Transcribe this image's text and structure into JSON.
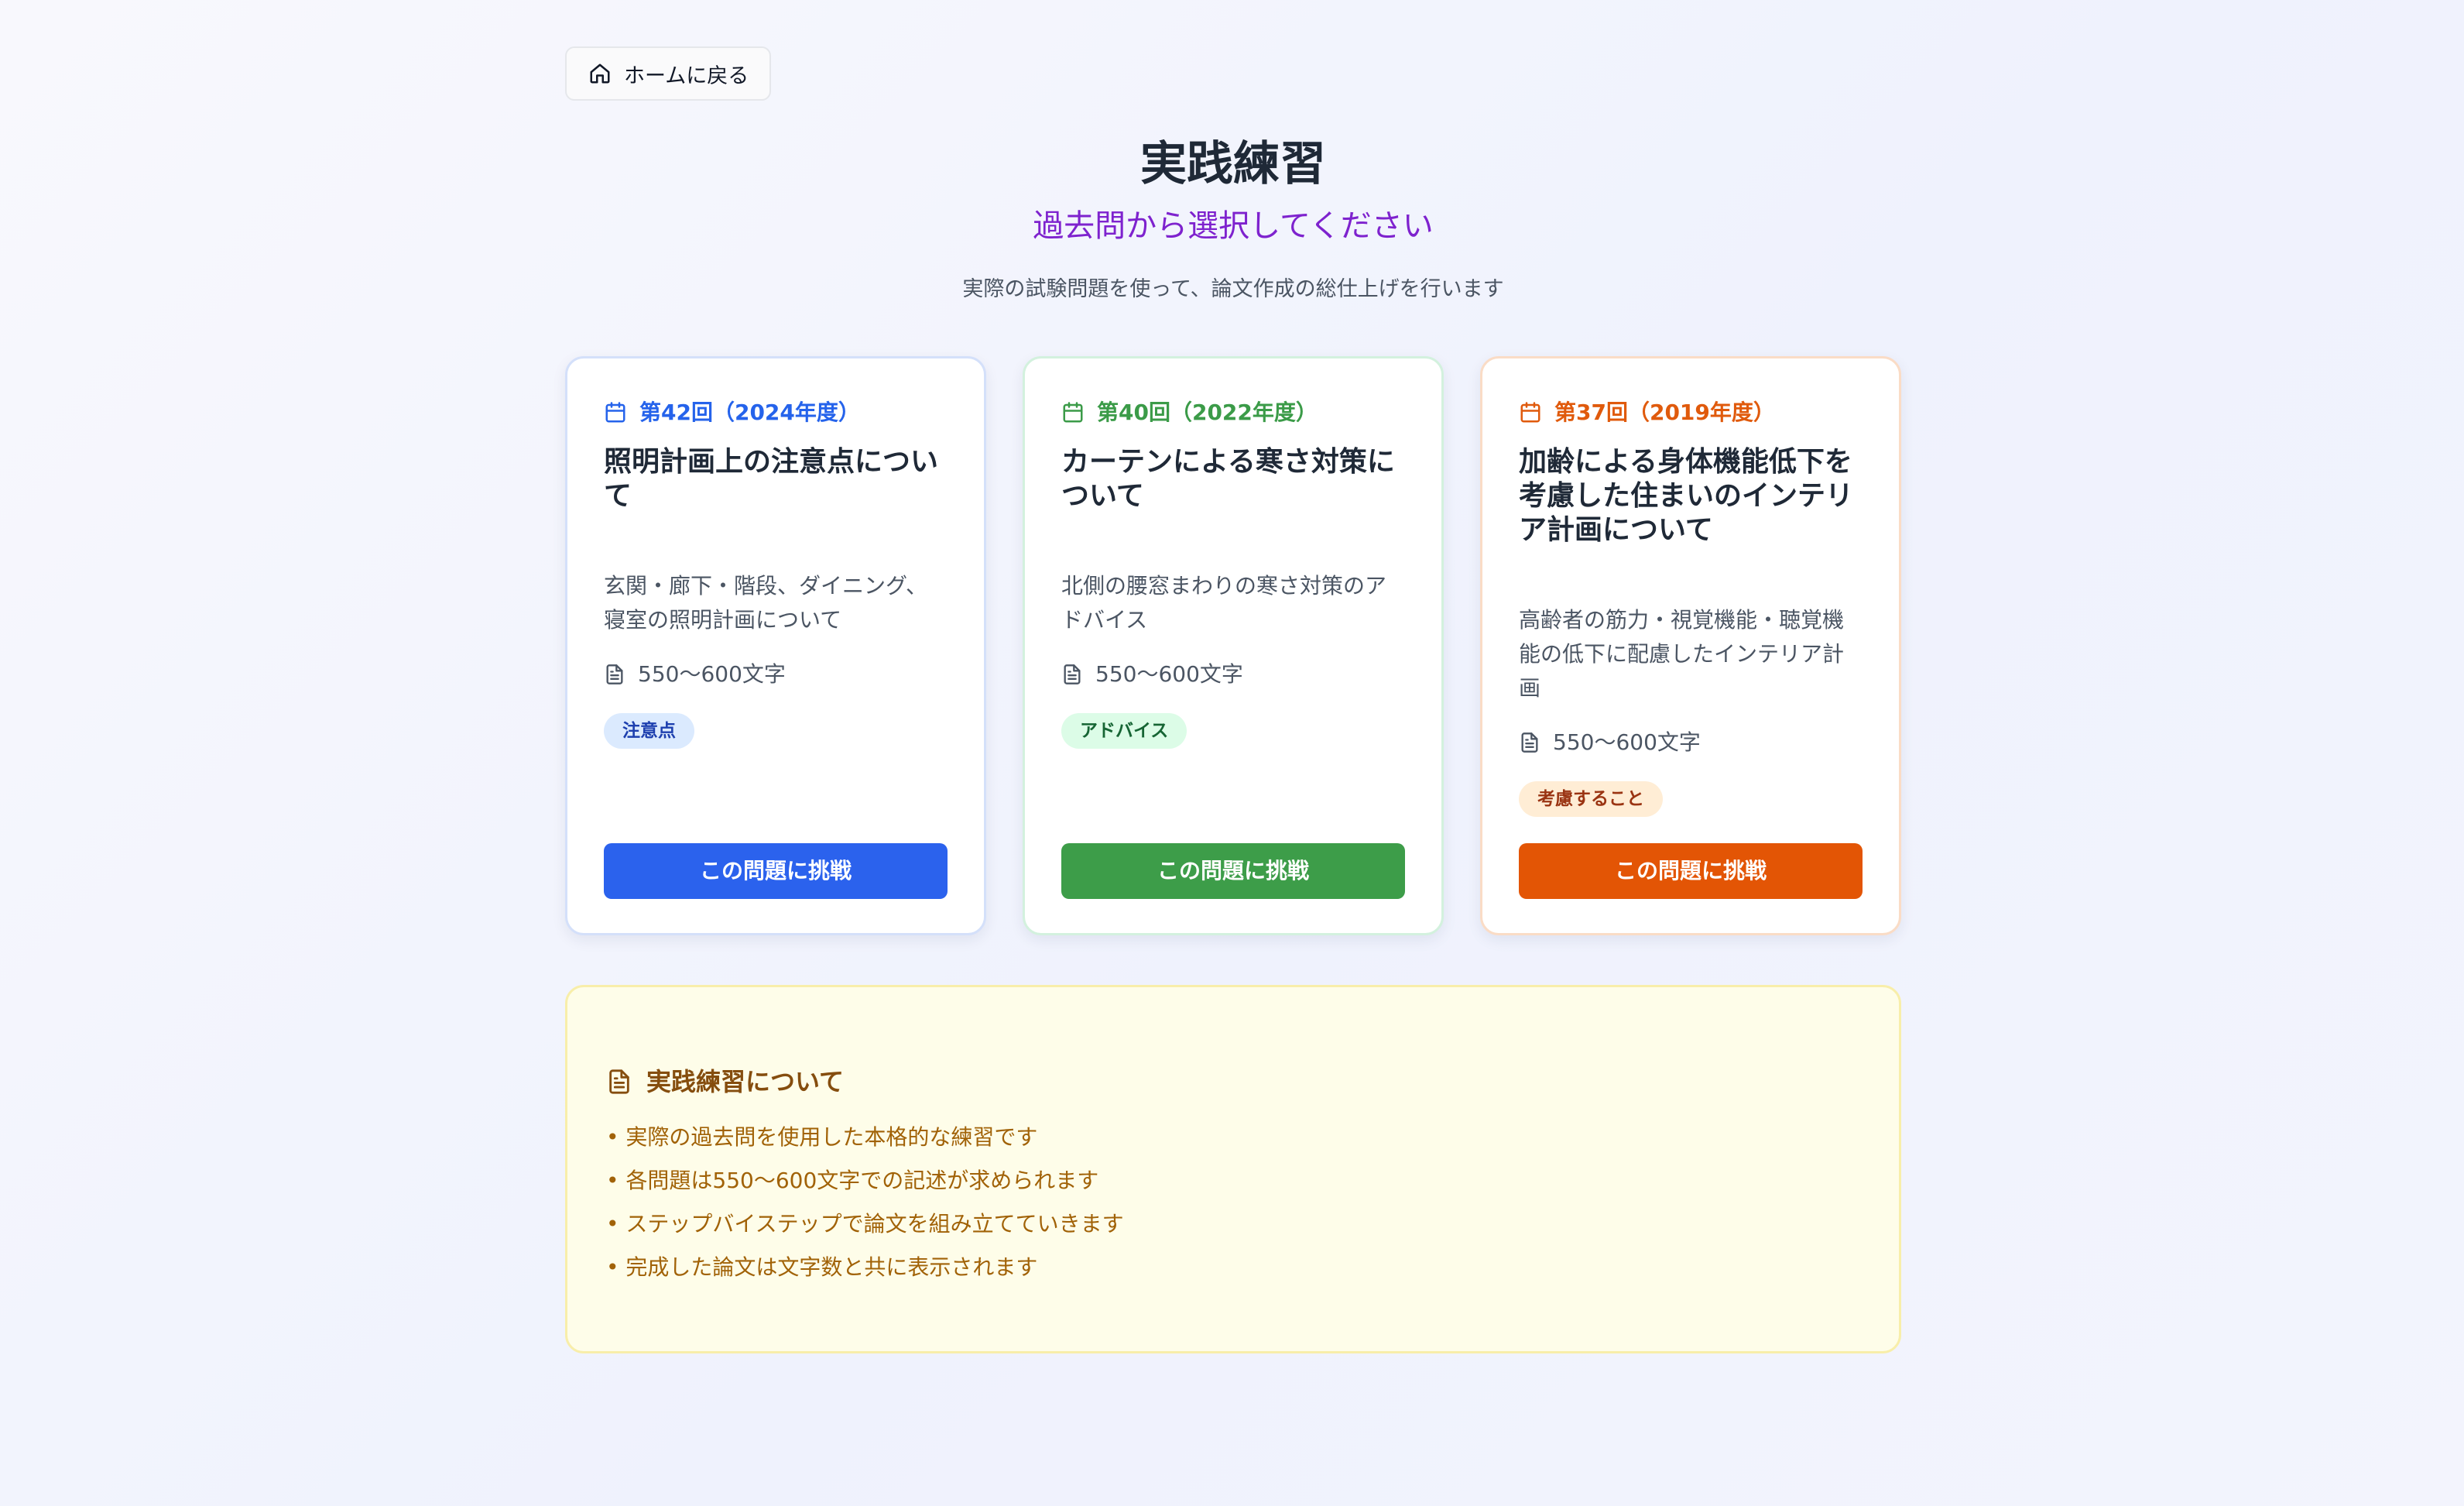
{
  "header": {
    "home_button_label": "ホームに戻る",
    "title": "実践練習",
    "subtitle": "過去問から選択してください",
    "description": "実際の試験問題を使って、論文作成の総仕上げを行います"
  },
  "cards": [
    {
      "date": "第42回（2024年度）",
      "title": "照明計画上の注意点について",
      "description": "玄関・廊下・階段、ダイニング、寝室の照明計画について",
      "char_count": "550〜600文字",
      "tag": "注意点",
      "button_label": "この問題に挑戦",
      "accent_color": "#2563eb"
    },
    {
      "date": "第40回（2022年度）",
      "title": "カーテンによる寒さ対策について",
      "description": "北側の腰窓まわりの寒さ対策のアドバイス",
      "char_count": "550〜600文字",
      "tag": "アドバイス",
      "button_label": "この問題に挑戦",
      "accent_color": "#3d9d49"
    },
    {
      "date": "第37回（2019年度）",
      "title": "加齢による身体機能低下を考慮した住まいのインテリア計画について",
      "description": "高齢者の筋力・視覚機能・聴覚機能の低下に配慮したインテリア計画",
      "char_count": "550〜600文字",
      "tag": "考慮すること",
      "button_label": "この問題に挑戦",
      "accent_color": "#e35505"
    }
  ],
  "info": {
    "title": "実践練習について",
    "items": [
      "• 実際の過去問を使用した本格的な練習です",
      "• 各問題は550〜600文字での記述が求められます",
      "• ステップバイステップで論文を組み立てていきます",
      "• 完成した論文は文字数と共に表示されます"
    ]
  }
}
